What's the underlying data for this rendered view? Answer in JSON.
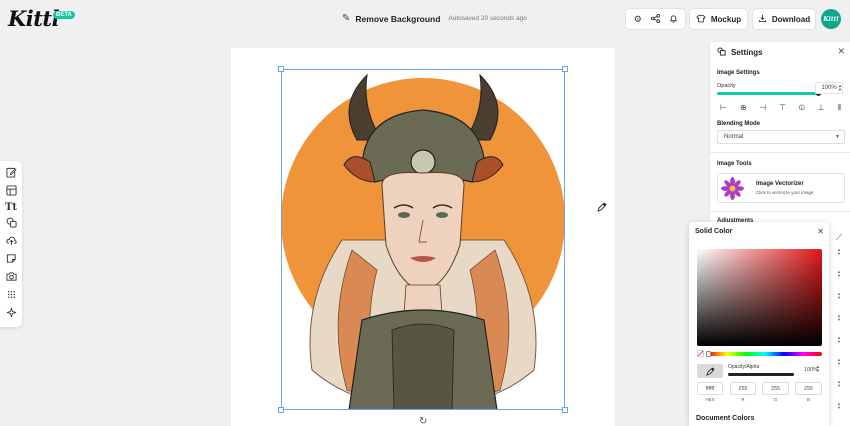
{
  "header": {
    "logo": "Kittl",
    "logo_badge": "BETA",
    "document_title": "Remove Background",
    "autosave_status": "Autosaved 20 seconds ago",
    "mockup_label": "Mockup",
    "download_label": "Download",
    "avatar_text": "Kittl"
  },
  "settings": {
    "title": "Settings",
    "image_settings_title": "Image Settings",
    "opacity_label": "Opacity",
    "opacity_value": "100%",
    "opacity_fraction": 1.0,
    "blending_mode_label": "Blending Mode",
    "blending_mode_value": "Normal",
    "image_tools_title": "Image Tools",
    "vectorizer_title": "Image Vectorizer",
    "vectorizer_subtitle": "Click to vectorize your image",
    "partially_hidden_title": "Adjustments"
  },
  "color_picker": {
    "title": "Solid Color",
    "alpha_label": "Opacity/Alpha",
    "alpha_value": "100%",
    "hex_value": "ffffff",
    "r_value": "255",
    "g_value": "255",
    "b_value": "255",
    "hex_label": "HEX",
    "r_label": "R",
    "g_label": "G",
    "b_label": "B",
    "document_colors_title": "Document Colors"
  },
  "colors": {
    "accent": "#13c7a3",
    "canvas_circle": "#f0943c",
    "selection": "#6aa6e8"
  },
  "icons": {
    "left_toolbar": [
      "edit-icon",
      "templates-icon",
      "text-icon",
      "shapes-icon",
      "upload-icon",
      "stickers-icon",
      "camera-icon",
      "grid-icon",
      "ai-sparkle-icon"
    ],
    "top_tools": [
      "settings-icon",
      "share-icon",
      "bell-icon"
    ]
  }
}
